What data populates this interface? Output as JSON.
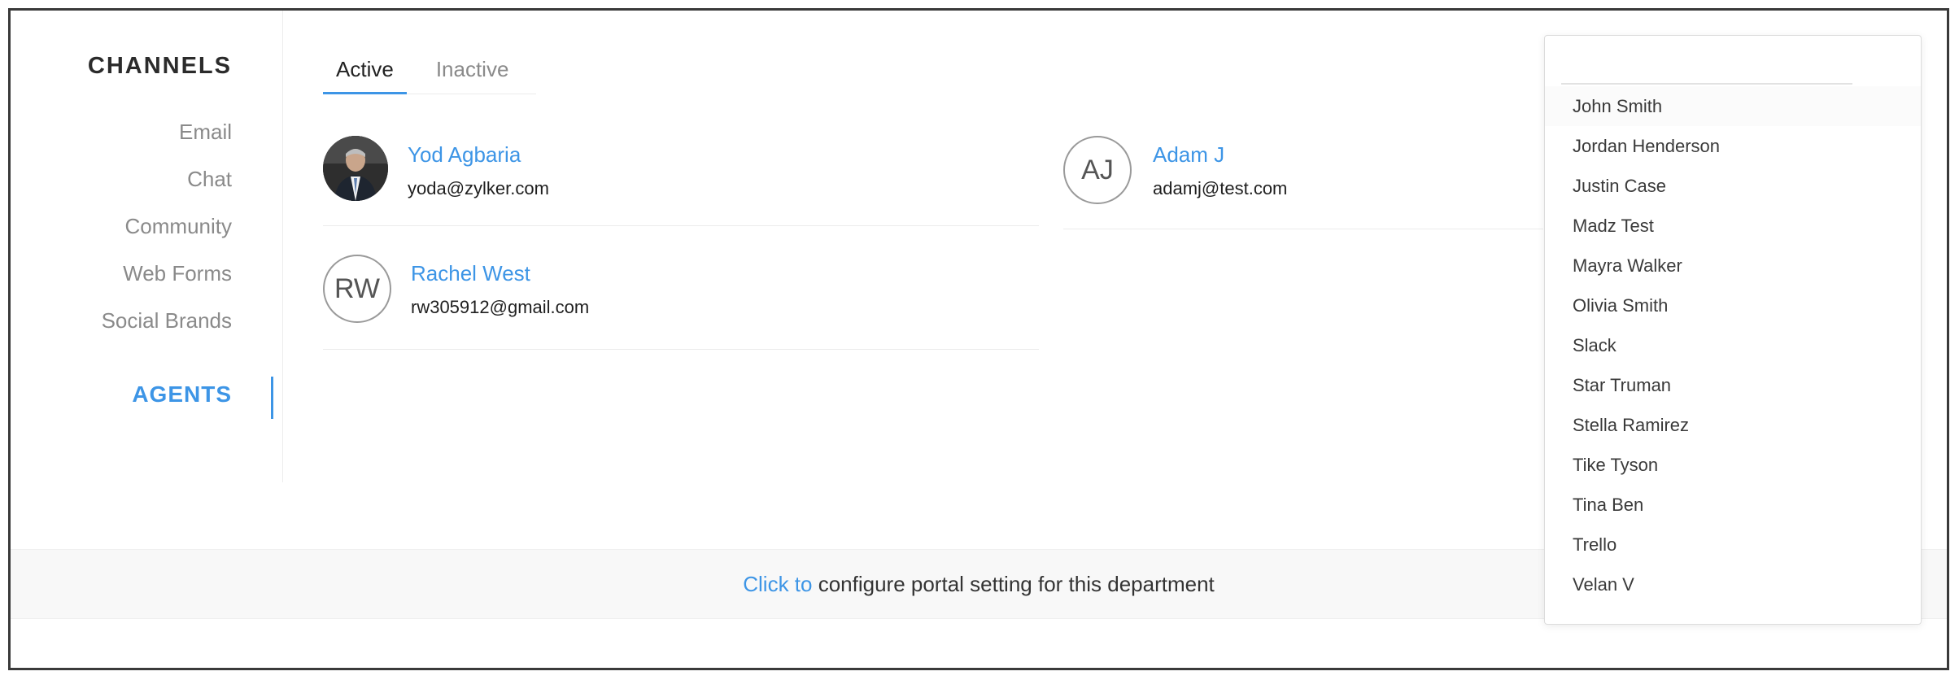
{
  "nav": {
    "heading": "CHANNELS",
    "items": [
      "Email",
      "Chat",
      "Community",
      "Web Forms",
      "Social Brands"
    ],
    "agents_label": "AGENTS"
  },
  "tabs": [
    {
      "label": "Active",
      "active": true
    },
    {
      "label": "Inactive",
      "active": false
    }
  ],
  "agents": [
    {
      "name": "Yod Agbaria",
      "email": "yoda@zylker.com",
      "avatar": "photo",
      "initials": ""
    },
    {
      "name": "Adam J",
      "email": "adamj@test.com",
      "avatar": "initials",
      "initials": "AJ"
    },
    {
      "name": "Rachel West",
      "email": "rw305912@gmail.com",
      "avatar": "initials",
      "initials": "RW"
    }
  ],
  "footer": {
    "link_text": "Click to",
    "text": " configure portal setting for this department"
  },
  "dropdown": {
    "search_value": "",
    "items": [
      "John Smith",
      "Jordan Henderson",
      "Justin Case",
      "Madz Test",
      "Mayra Walker",
      "Olivia Smith",
      "Slack",
      "Star Truman",
      "Stella Ramirez",
      "Tike Tyson",
      "Tina Ben",
      "Trello",
      "Velan V"
    ]
  },
  "colors": {
    "accent": "#3d95e6",
    "muted_text": "#8a8a8a"
  }
}
